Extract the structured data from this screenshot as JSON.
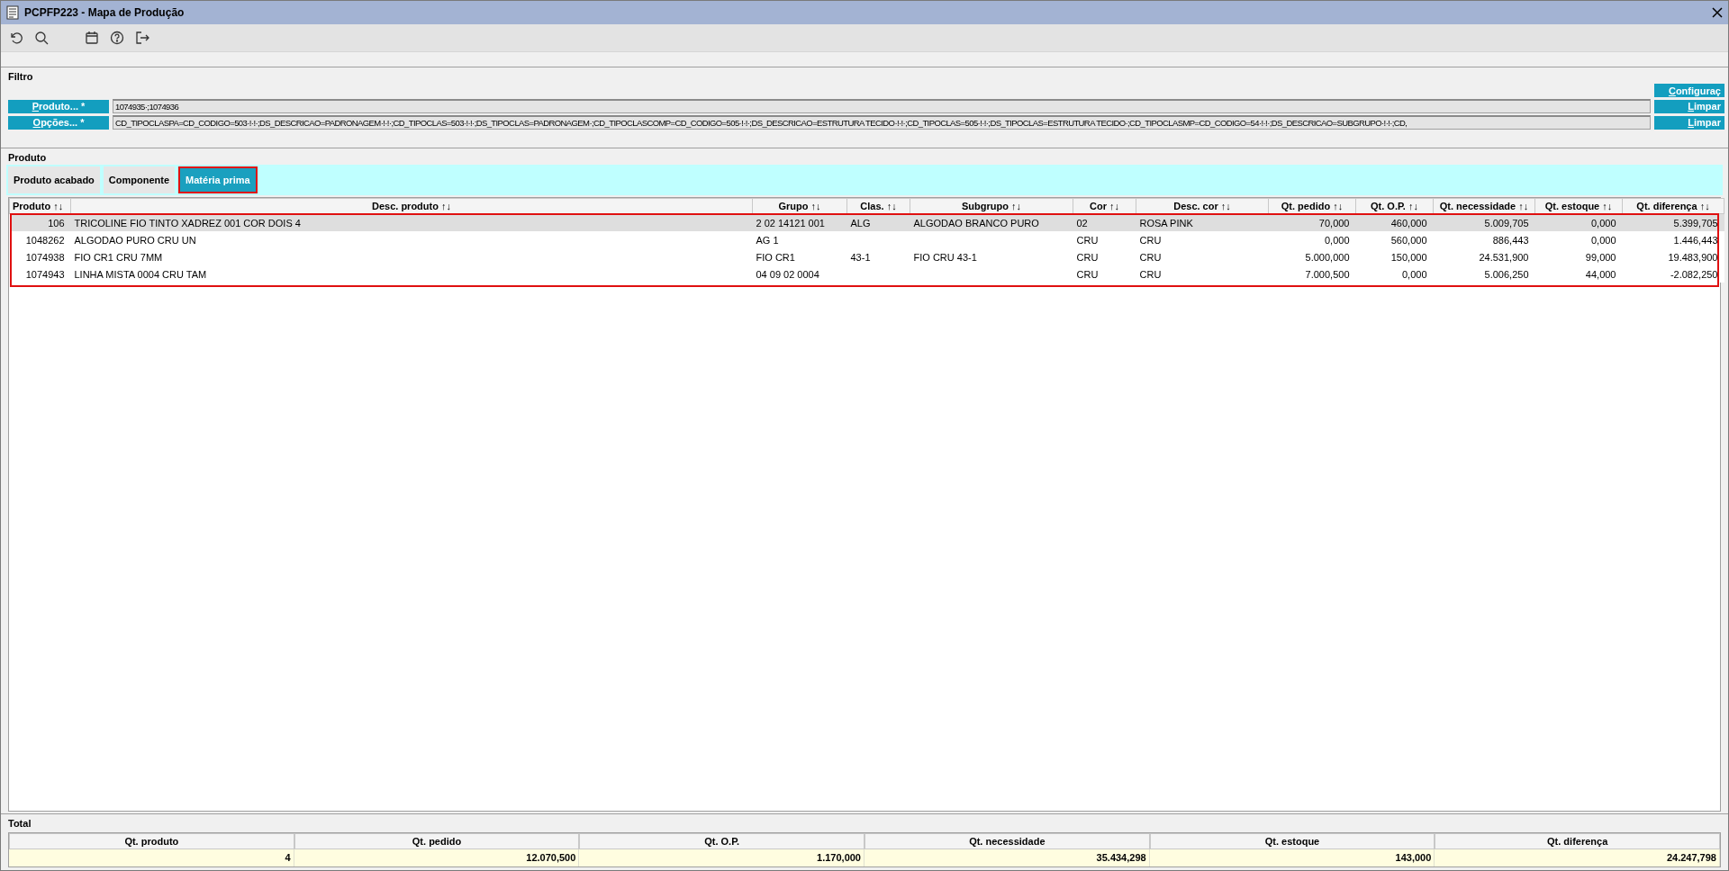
{
  "window": {
    "title": "PCPFP223 - Mapa de Produção"
  },
  "toolbar": {
    "buttons": [
      {
        "kind": "undo"
      },
      {
        "kind": "search"
      },
      {
        "kind": "calendar"
      },
      {
        "kind": "help"
      },
      {
        "kind": "exit"
      }
    ]
  },
  "filter": {
    "title": "Filtro",
    "fields": [
      {
        "label": "Produto... *",
        "value": "1074935·;1074936",
        "action": "Limpar"
      },
      {
        "label": "Opções... *",
        "value": "CD_TIPOCLASPA=CD_CODIGO=503·!·!·;DS_DESCRICAO=PADRONAGEM·!·!·;CD_TIPOCLAS=503·!·!·;DS_TIPOCLAS=PADRONAGEM·;CD_TIPOCLASCOMP=CD_CODIGO=505·!·!·;DS_DESCRICAO=ESTRUTURA TECIDO·!·!·;CD_TIPOCLAS=505·!·!·;DS_TIPOCLAS=ESTRUTURA TECIDO·;CD_TIPOCLASMP=CD_CODIGO=54·!·!·;DS_DESCRICAO=SUBGRUPO·!·!·;CD,",
        "action": "Limpar"
      }
    ],
    "config_button": "Configuraç"
  },
  "product": {
    "title": "Produto",
    "tabs": [
      {
        "label": "Produto acabado",
        "selected": false
      },
      {
        "label": "Componente",
        "selected": false
      },
      {
        "label": "Matéria prima",
        "selected": true
      }
    ]
  },
  "table": {
    "columns": [
      "Produto ↑↓",
      "Desc. produto ↑↓",
      "Grupo ↑↓",
      "Clas. ↑↓",
      "Subgrupo ↑↓",
      "Cor ↑↓",
      "Desc. cor ↑↓",
      "Qt. pedido ↑↓",
      "Qt. O.P. ↑↓",
      "Qt. necessidade ↑↓",
      "Qt. estoque ↑↓",
      "Qt. diferença ↑↓"
    ],
    "rows": [
      {
        "selected": true,
        "cells": [
          "106",
          "TRICOLINE FIO TINTO XADREZ 001 COR DOIS 4",
          "2 02 14121 001",
          "ALG",
          "ALGODAO BRANCO PURO",
          "02",
          "ROSA PINK",
          "70,000",
          "460,000",
          "5.009,705",
          "0,000",
          "5.399,705"
        ]
      },
      {
        "selected": false,
        "cells": [
          "1048262",
          "ALGODAO PURO CRU UN",
          "AG 1",
          "",
          "",
          "CRU",
          "CRU",
          "0,000",
          "560,000",
          "886,443",
          "0,000",
          "1.446,443"
        ]
      },
      {
        "selected": false,
        "cells": [
          "1074938",
          "FIO CR1 CRU 7MM",
          "FIO CR1",
          "43-1",
          "FIO CRU 43-1",
          "CRU",
          "CRU",
          "5.000,000",
          "150,000",
          "24.531,900",
          "99,000",
          "19.483,900"
        ]
      },
      {
        "selected": false,
        "cells": [
          "1074943",
          "LINHA MISTA 0004 CRU TAM",
          "04 09 02 0004",
          "",
          "",
          "CRU",
          "CRU",
          "7.000,500",
          "0,000",
          "5.006,250",
          "44,000",
          "-2.082,250"
        ]
      }
    ]
  },
  "totals": {
    "title": "Total",
    "columns": [
      "Qt. produto",
      "Qt. pedido",
      "Qt. O.P.",
      "Qt. necessidade",
      "Qt. estoque",
      "Qt. diferença"
    ],
    "values": [
      "4",
      "12.070,500",
      "1.170,000",
      "35.434,298",
      "143,000",
      "24.247,798"
    ]
  }
}
